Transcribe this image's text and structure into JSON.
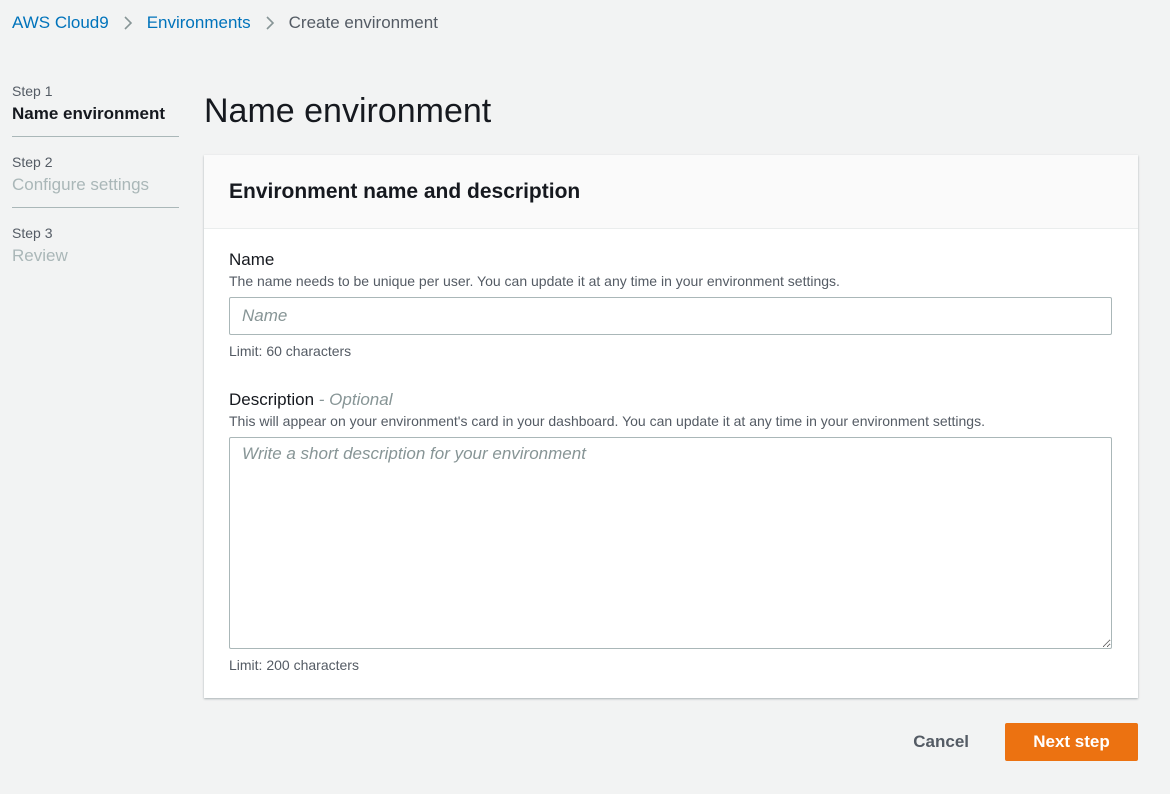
{
  "breadcrumb": {
    "items": [
      {
        "label": "AWS Cloud9"
      },
      {
        "label": "Environments"
      },
      {
        "label": "Create environment"
      }
    ]
  },
  "steps": [
    {
      "number": "Step 1",
      "title": "Name environment",
      "state": "active"
    },
    {
      "number": "Step 2",
      "title": "Configure settings",
      "state": "inactive"
    },
    {
      "number": "Step 3",
      "title": "Review",
      "state": "inactive"
    }
  ],
  "page": {
    "title": "Name environment"
  },
  "panel": {
    "title": "Environment name and description",
    "name_field": {
      "label": "Name",
      "description": "The name needs to be unique per user. You can update it at any time in your environment settings.",
      "placeholder": "Name",
      "value": "",
      "limit": "Limit: 60 characters"
    },
    "description_field": {
      "label": "Description",
      "optional": "- Optional",
      "description": "This will appear on your environment's card in your dashboard. You can update it at any time in your environment settings.",
      "placeholder": "Write a short description for your environment",
      "value": "",
      "limit": "Limit: 200 characters"
    }
  },
  "actions": {
    "cancel_label": "Cancel",
    "next_label": "Next step"
  },
  "colors": {
    "link": "#0073bb",
    "primary": "#ec7211",
    "background": "#f2f3f3"
  },
  "icons": {
    "breadcrumb_separator": "chevron-right-icon"
  }
}
